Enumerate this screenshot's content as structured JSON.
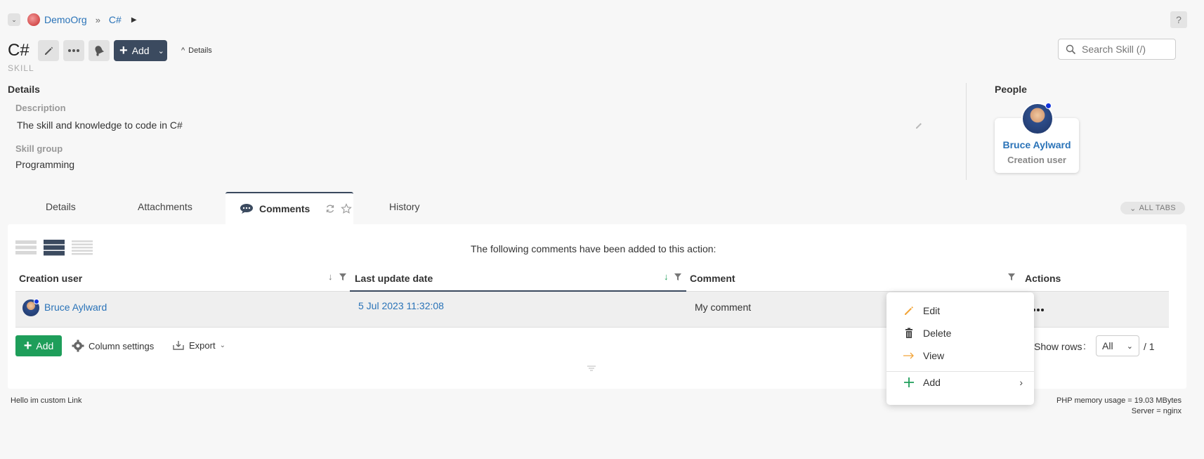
{
  "breadcrumb": {
    "org": "DemoOrg",
    "separator": "»",
    "current": "C#"
  },
  "header": {
    "title": "C#",
    "subtitle": "SKILL",
    "add_label": "Add",
    "details_toggle": "Details",
    "help_label": "?"
  },
  "search": {
    "placeholder": "Search Skill (/)"
  },
  "details": {
    "heading": "Details",
    "description_label": "Description",
    "description_value": "The skill and knowledge to code in C#",
    "skill_group_label": "Skill group",
    "skill_group_value": "Programming"
  },
  "people": {
    "heading": "People",
    "person_name": "Bruce Aylward",
    "person_role": "Creation user"
  },
  "tabs": {
    "details": "Details",
    "attachments": "Attachments",
    "comments": "Comments",
    "history": "History",
    "all_tabs": "ALL TABS"
  },
  "comments_panel": {
    "message": "The following comments have been added to this action:",
    "columns": {
      "creation_user": "Creation user",
      "last_update": "Last update date",
      "comment": "Comment",
      "actions": "Actions"
    },
    "rows": [
      {
        "user": "Bruce Aylward",
        "date": "5 Jul 2023 11:32:08",
        "comment": "My comment"
      }
    ],
    "add_label": "Add",
    "column_settings_label": "Column settings",
    "export_label": "Export",
    "show_rows_label": "Show rows",
    "show_rows_value": "All",
    "page_count": "/ 1"
  },
  "context_menu": {
    "edit": "Edit",
    "delete": "Delete",
    "view": "View",
    "add": "Add"
  },
  "footer": {
    "custom_link": "Hello im custom Link",
    "memory": "PHP memory usage = 19.03 MBytes",
    "server": "Server = nginx"
  },
  "colors": {
    "accent_dark": "#3b4a5f",
    "link_blue": "#2a73b8",
    "add_green": "#1e9e5a",
    "edit_orange": "#f2a53a",
    "online_blue": "#1133dd"
  }
}
